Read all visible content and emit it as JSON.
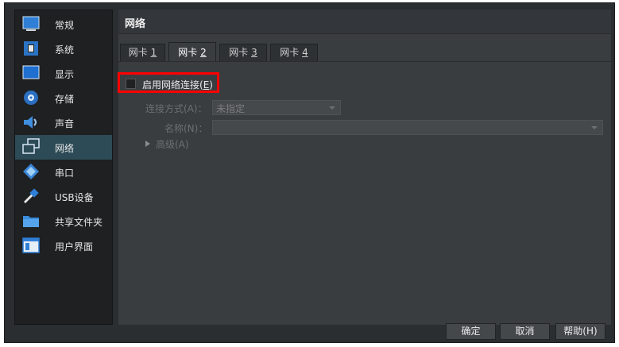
{
  "sidebar": {
    "items": [
      {
        "label": "常规",
        "icon": "general-icon"
      },
      {
        "label": "系统",
        "icon": "system-icon"
      },
      {
        "label": "显示",
        "icon": "display-icon"
      },
      {
        "label": "存储",
        "icon": "storage-icon"
      },
      {
        "label": "声音",
        "icon": "audio-icon"
      },
      {
        "label": "网络",
        "icon": "network-icon",
        "active": true
      },
      {
        "label": "串口",
        "icon": "serial-port-icon"
      },
      {
        "label": "USB设备",
        "icon": "usb-icon"
      },
      {
        "label": "共享文件夹",
        "icon": "shared-folder-icon"
      },
      {
        "label": "用户界面",
        "icon": "user-interface-icon"
      }
    ]
  },
  "main": {
    "title": "网络",
    "tabs": [
      {
        "prefix": "网卡 ",
        "key": "1",
        "active": false
      },
      {
        "prefix": "网卡 ",
        "key": "2",
        "active": true
      },
      {
        "prefix": "网卡 ",
        "key": "3",
        "active": false
      },
      {
        "prefix": "网卡 ",
        "key": "4",
        "active": false
      }
    ],
    "enable_label": "启用网络连接(",
    "enable_key": "E",
    "enable_suffix": ")",
    "attach_label": "连接方式(A)：",
    "attach_value": "未指定",
    "name_label": "名称(N)：",
    "name_value": "",
    "advanced_label": "高级(A)"
  },
  "buttons": {
    "ok": "确定",
    "cancel": "取消",
    "help": "帮助(H)"
  },
  "colors": {
    "accent_active": "#2d4b56",
    "highlight": "#ff0000"
  }
}
